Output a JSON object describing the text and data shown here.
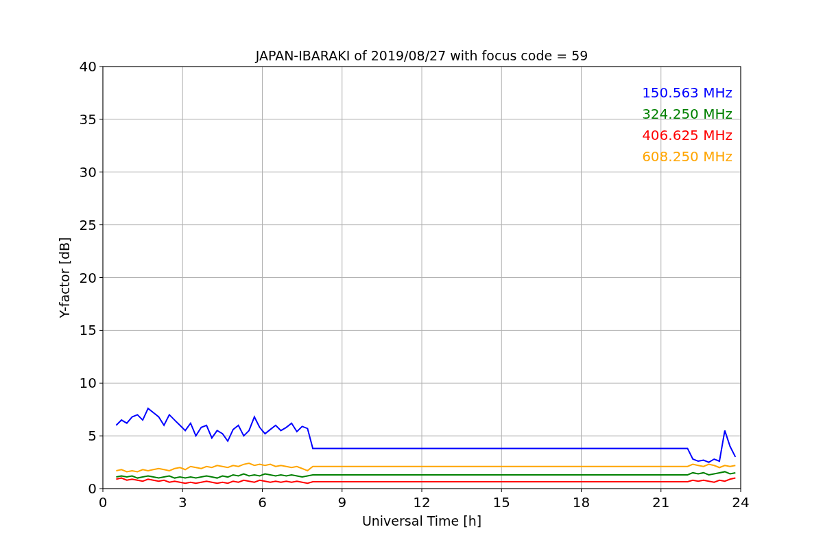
{
  "figure": {
    "chart_data": {
      "type": "line",
      "title": "JAPAN-IBARAKI of 2019/08/27 with focus code = 59",
      "xlabel": "Universal Time [h]",
      "ylabel": "Y-factor [dB]",
      "x": [
        0.5,
        0.7,
        0.9,
        1.1,
        1.3,
        1.5,
        1.7,
        1.9,
        2.1,
        2.3,
        2.5,
        2.7,
        2.9,
        3.1,
        3.3,
        3.5,
        3.7,
        3.9,
        4.1,
        4.3,
        4.5,
        4.7,
        4.9,
        5.1,
        5.3,
        5.5,
        5.7,
        5.9,
        6.1,
        6.3,
        6.5,
        6.7,
        6.9,
        7.1,
        7.3,
        7.5,
        7.7,
        7.9,
        22.0,
        22.2,
        22.4,
        22.6,
        22.8,
        23.0,
        23.2,
        23.4,
        23.6,
        23.8
      ],
      "series": [
        {
          "name": "150.563 MHz",
          "color": "#0000ff",
          "values": [
            6.0,
            6.5,
            6.2,
            6.8,
            7.0,
            6.5,
            7.6,
            7.2,
            6.8,
            6.0,
            7.0,
            6.5,
            6.0,
            5.5,
            6.2,
            5.0,
            5.8,
            6.0,
            4.8,
            5.5,
            5.2,
            4.5,
            5.6,
            6.0,
            5.0,
            5.5,
            6.8,
            5.8,
            5.2,
            5.6,
            6.0,
            5.5,
            5.8,
            6.2,
            5.4,
            5.9,
            5.7,
            3.8,
            3.8,
            2.8,
            2.6,
            2.7,
            2.5,
            2.8,
            2.6,
            5.5,
            4.0,
            3.0
          ]
        },
        {
          "name": "324.250 MHz",
          "color": "#008000",
          "values": [
            1.1,
            1.2,
            1.1,
            1.2,
            1.0,
            1.1,
            1.2,
            1.1,
            1.0,
            1.1,
            1.2,
            1.0,
            1.1,
            1.0,
            1.1,
            1.0,
            1.1,
            1.2,
            1.1,
            1.0,
            1.2,
            1.1,
            1.3,
            1.2,
            1.4,
            1.2,
            1.3,
            1.2,
            1.4,
            1.3,
            1.2,
            1.3,
            1.2,
            1.3,
            1.2,
            1.1,
            1.2,
            1.3,
            1.3,
            1.5,
            1.4,
            1.5,
            1.3,
            1.4,
            1.5,
            1.6,
            1.4,
            1.5
          ]
        },
        {
          "name": "406.625 MHz",
          "color": "#ff0000",
          "values": [
            0.9,
            1.0,
            0.8,
            0.9,
            0.8,
            0.7,
            0.9,
            0.8,
            0.7,
            0.8,
            0.6,
            0.7,
            0.6,
            0.5,
            0.6,
            0.5,
            0.6,
            0.7,
            0.6,
            0.5,
            0.6,
            0.5,
            0.7,
            0.6,
            0.8,
            0.7,
            0.6,
            0.8,
            0.7,
            0.6,
            0.7,
            0.6,
            0.7,
            0.6,
            0.7,
            0.6,
            0.5,
            0.65,
            0.65,
            0.8,
            0.7,
            0.8,
            0.7,
            0.6,
            0.8,
            0.7,
            0.9,
            1.0
          ]
        },
        {
          "name": "608.250 MHz",
          "color": "#ffa500",
          "values": [
            1.7,
            1.8,
            1.6,
            1.7,
            1.6,
            1.8,
            1.7,
            1.8,
            1.9,
            1.8,
            1.7,
            1.9,
            2.0,
            1.8,
            2.1,
            2.0,
            1.9,
            2.1,
            2.0,
            2.2,
            2.1,
            2.0,
            2.2,
            2.1,
            2.3,
            2.4,
            2.2,
            2.3,
            2.2,
            2.3,
            2.1,
            2.2,
            2.1,
            2.0,
            2.1,
            1.9,
            1.7,
            2.1,
            2.1,
            2.3,
            2.2,
            2.1,
            2.3,
            2.2,
            2.0,
            2.2,
            2.1,
            2.2
          ]
        }
      ],
      "xlim": [
        0,
        24
      ],
      "ylim": [
        0,
        40
      ],
      "xticks": [
        0,
        3,
        6,
        9,
        12,
        15,
        18,
        21,
        24
      ],
      "yticks": [
        0,
        5,
        10,
        15,
        20,
        25,
        30,
        35,
        40
      ],
      "grid": true
    }
  }
}
